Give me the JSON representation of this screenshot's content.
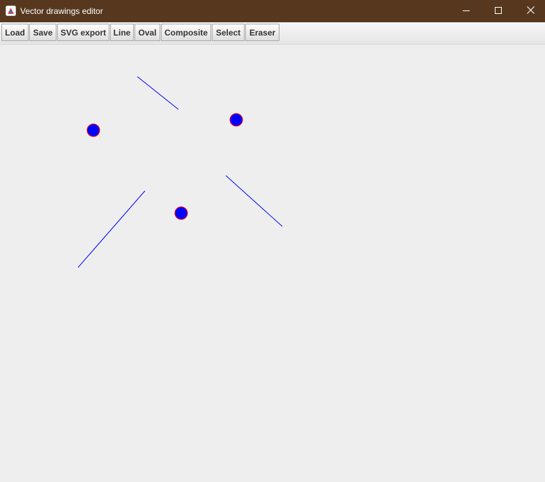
{
  "window": {
    "title": "Vector drawings editor",
    "titlebar_color": "#57381e",
    "controls": {
      "minimize": "minimize-icon",
      "maximize": "maximize-icon",
      "close": "close-icon"
    }
  },
  "toolbar": {
    "buttons": [
      {
        "id": "load",
        "label": "Load"
      },
      {
        "id": "save",
        "label": "Save"
      },
      {
        "id": "svg-export",
        "label": "SVG export"
      },
      {
        "id": "line",
        "label": "Line"
      },
      {
        "id": "oval",
        "label": "Oval"
      },
      {
        "id": "composite",
        "label": "Composite"
      },
      {
        "id": "select",
        "label": "Select"
      },
      {
        "id": "eraser",
        "label": "Eraser"
      }
    ]
  },
  "canvas": {
    "background": "#eeeeee",
    "line_color": "#0000ff",
    "oval_fill": "#0000ff",
    "oval_outline": "#ff0000"
  }
}
